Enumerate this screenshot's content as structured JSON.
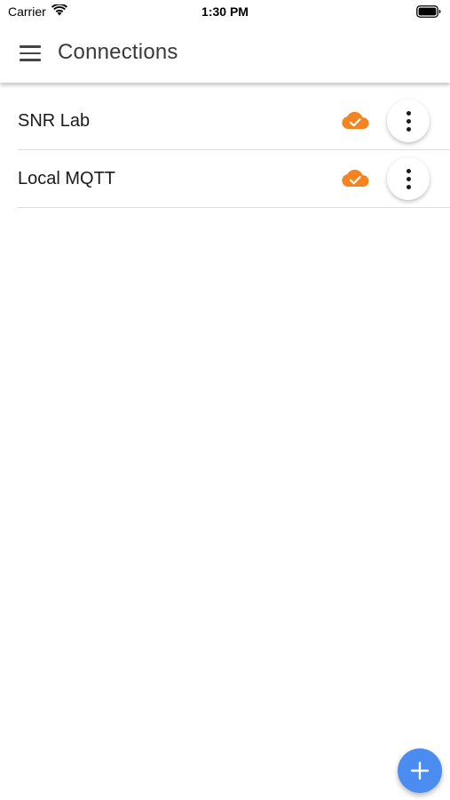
{
  "status_bar": {
    "carrier": "Carrier",
    "time": "1:30 PM",
    "icons": [
      "wifi-icon",
      "battery-icon"
    ]
  },
  "app_bar": {
    "title": "Connections",
    "menu_icon": "hamburger-menu-icon"
  },
  "connections": [
    {
      "name": "SNR Lab",
      "status_icon": "cloud-done-icon",
      "action_icon": "more-vertical-icon"
    },
    {
      "name": "Local MQTT",
      "status_icon": "cloud-done-icon",
      "action_icon": "more-vertical-icon"
    }
  ],
  "fab": {
    "icon": "plus-icon"
  },
  "colors": {
    "cloud_status": "#f5831f",
    "fab": "#4a8cf0",
    "title_text": "#3a3a3a"
  }
}
